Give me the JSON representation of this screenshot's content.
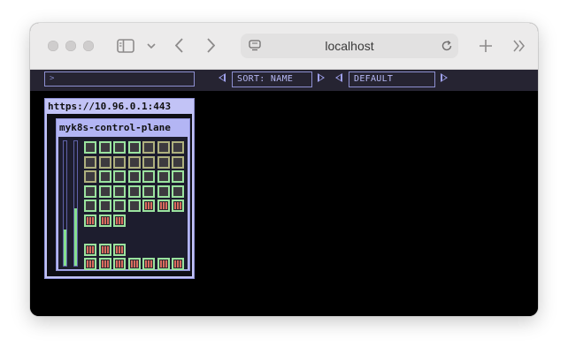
{
  "browser": {
    "address": "localhost",
    "icons": [
      "sidebar-icon",
      "chevron-down-icon",
      "back-icon",
      "forward-icon",
      "page-icon",
      "reload-icon",
      "new-tab-icon",
      "more-tabs-icon"
    ]
  },
  "toolbar": {
    "filter_placeholder": ">",
    "sort_label": "SORT: NAME",
    "mode_label": "DEFAULT"
  },
  "cluster": {
    "endpoint": "https://10.96.0.1:443",
    "nodes": [
      {
        "name": "myk8s-control-plane",
        "cpu_fraction": 0.29,
        "memory_fraction": 0.46,
        "pod_rows": [
          [
            "run",
            "run",
            "run",
            "run",
            "olive",
            "olive",
            "olive"
          ],
          [
            "olive",
            "olive",
            "olive",
            "olive",
            "olive",
            "olive",
            "olive"
          ],
          [
            "olive",
            "run",
            "run",
            "run",
            "run",
            "run",
            "run"
          ],
          [
            "run",
            "run",
            "run",
            "run",
            "run",
            "run",
            "run"
          ],
          [
            "run",
            "run",
            "run",
            "run",
            "job",
            "job",
            "job"
          ],
          [
            "job",
            "job",
            "job"
          ],
          [],
          [
            "job",
            "job",
            "job"
          ],
          [
            "job",
            "job",
            "job",
            "job",
            "job",
            "job",
            "job"
          ]
        ]
      }
    ]
  },
  "colors": {
    "toolbar_bg": "#262432",
    "accent": "#9ea0ea",
    "cluster_bg": "#c2c3f6",
    "node_bg": "#b3b5f4",
    "pod_ready_border": "#9ae29e",
    "pod_pending_border": "#aeb07e",
    "pod_job_stripe": "#d96b5e"
  }
}
